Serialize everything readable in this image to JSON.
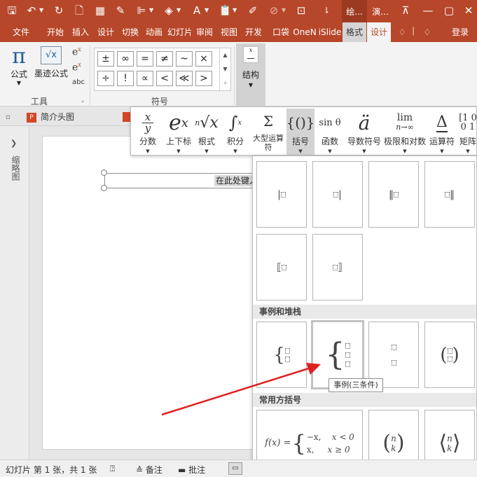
{
  "titlebar": {
    "bg_color": "#b7472a",
    "quick_access": [
      "save-icon",
      "undo-icon",
      "redo-icon",
      "new-icon",
      "grid-icon",
      "eyedropper-icon",
      "align-icon",
      "fill-icon",
      "font-color-icon",
      "paste-icon",
      "format-painter-icon",
      "disabled-icon",
      "selection-icon"
    ],
    "context_tabs": [
      "绘...",
      "演..."
    ]
  },
  "ribbon_tabs": [
    "文件",
    "开始",
    "插入",
    "设计",
    "切换",
    "动画",
    "幻灯片",
    "审阅",
    "视图",
    "开发",
    "口袋",
    "OneN",
    "iSlide",
    "格式",
    "设计"
  ],
  "ribbon_right": {
    "signin": "登录"
  },
  "tools_group": {
    "equation_label": "公式",
    "ink_label": "墨迹公式",
    "abc_label": "abc",
    "group_label": "工具"
  },
  "symbols_group": {
    "row1": [
      "±",
      "∞",
      "=",
      "≠",
      "~",
      "×"
    ],
    "row2": [
      "÷",
      "!",
      "∝",
      "<",
      "≪",
      ">"
    ],
    "group_label": "符号"
  },
  "structure_group": {
    "label": "结构"
  },
  "doc_tabs": [
    "简介头图"
  ],
  "left_pane": {
    "label": "缩略图"
  },
  "slide": {
    "placeholder_text": "在此处键入公式。"
  },
  "structures": [
    {
      "name": "fraction",
      "label": "分数"
    },
    {
      "name": "script",
      "label": "上下标"
    },
    {
      "name": "radical",
      "label": "根式"
    },
    {
      "name": "integral",
      "label": "积分"
    },
    {
      "name": "large-operator",
      "label": "大型运算符"
    },
    {
      "name": "bracket",
      "label": "括号"
    },
    {
      "name": "function",
      "label": "函数",
      "glyph": "sin θ"
    },
    {
      "name": "accent",
      "label": "导数符号"
    },
    {
      "name": "limit-log",
      "label": "极限和对数",
      "glyph_top": "lim",
      "glyph_bottom": "n→∞"
    },
    {
      "name": "operator",
      "label": "运算符"
    },
    {
      "name": "matrix",
      "label": "矩阵"
    }
  ],
  "gallery": {
    "sections": [
      {
        "title": "事例和堆栈"
      },
      {
        "title": "常用方括号"
      }
    ],
    "tooltip": "事例(三条件)",
    "cases_formula": {
      "lhs": "f(x) =",
      "row1": "−x,",
      "row1_cond": "x < 0",
      "row2": "x,",
      "row2_cond": "x ≥ 0"
    }
  },
  "statusbar": {
    "slide_info": "幻灯片 第 1 张，共 1 张",
    "notes": "备注",
    "comments": "批注"
  }
}
